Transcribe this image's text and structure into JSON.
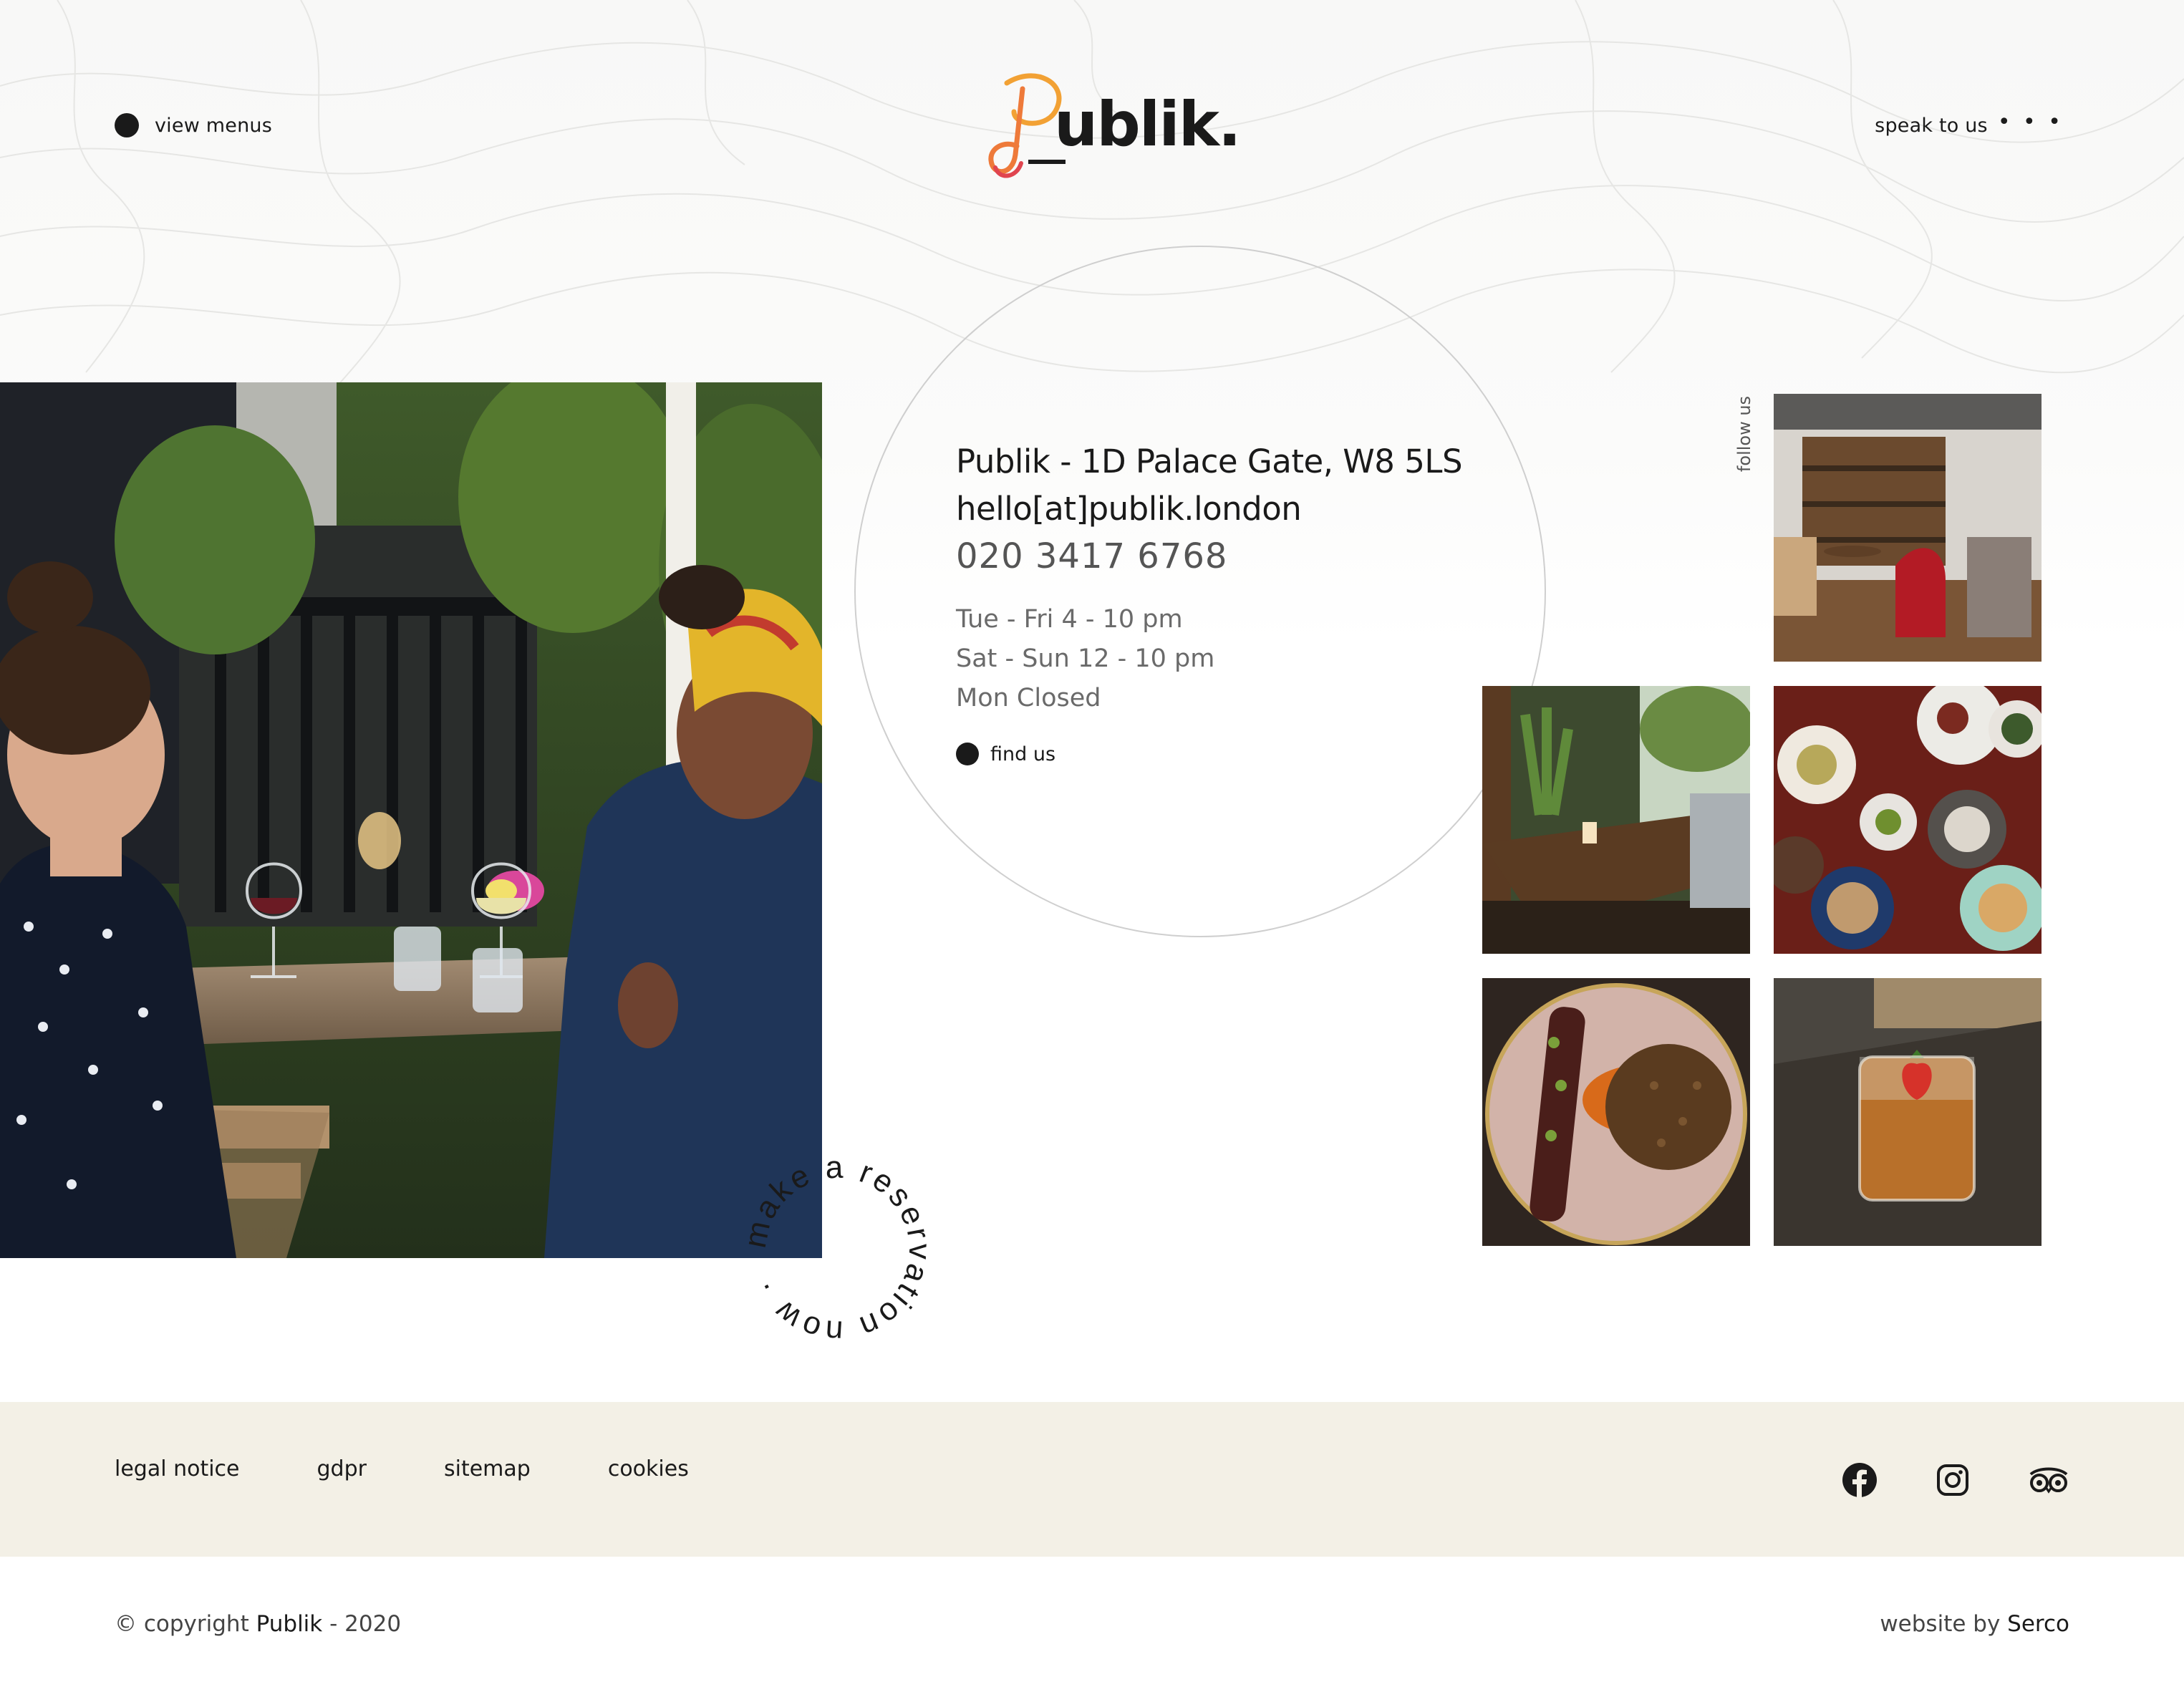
{
  "header": {
    "view_menus": "view menus",
    "speak_to_us": "speak to us",
    "more_dots": "• • •",
    "logo_text": "ublik.",
    "logo_alt": "Publik."
  },
  "contact": {
    "address": "Publik - 1D Palace Gate, W8 5LS",
    "email": "hello[at]publik.london",
    "phone": "020 3417 6768",
    "hours": [
      "Tue - Fri 4 - 10 pm",
      "Sat - Sun 12 - 10 pm",
      "Mon Closed"
    ],
    "find_us": "find us"
  },
  "reservation_text": "make a reservation now ·",
  "follow_us": "follow us",
  "gallery": {
    "tiles": [
      "restaurant-interior-photo",
      "terrace-bar-photo",
      "table-dishes-photo",
      "steak-lentils-photo",
      "cocktail-photo"
    ]
  },
  "footer": {
    "links": [
      "legal notice",
      "gdpr",
      "sitemap",
      "cookies"
    ],
    "social": [
      "facebook-icon",
      "instagram-icon",
      "tripadvisor-icon"
    ]
  },
  "bottom": {
    "copyright_prefix": "© copyright",
    "brand": "Publik",
    "copyright_suffix": "- 2020",
    "website_by_prefix": "website by",
    "agency": "Serco"
  },
  "colors": {
    "accent_orange": "#f2a134",
    "accent_red": "#e0454f",
    "footer_bg": "#f3f0e6",
    "text": "#1c1c1c"
  }
}
